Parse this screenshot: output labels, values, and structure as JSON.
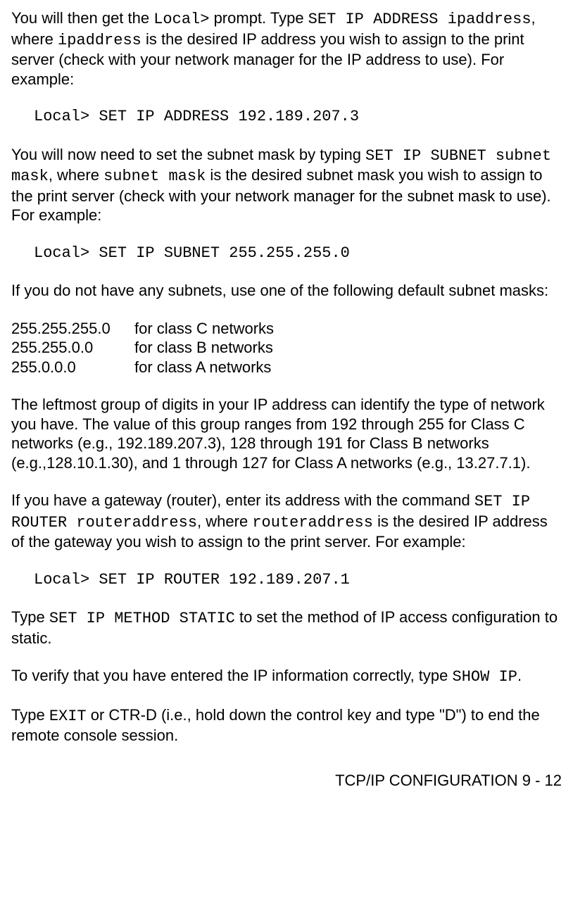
{
  "para1": {
    "t1": "You will then get the ",
    "c1": "Local>",
    "t2": " prompt. Type ",
    "c2": "SET IP ADDRESS ipaddress",
    "t3": ", where ",
    "c3": "ipaddress",
    "t4": " is the desired IP address you wish to assign to the print server (check with your network manager for the IP address to use). For example:"
  },
  "code1": "Local> SET IP ADDRESS 192.189.207.3",
  "para2": {
    "t1": "You will now need to set the subnet mask by typing ",
    "c1": "SET IP SUBNET subnet mask",
    "t2": ", where ",
    "c2": "subnet mask",
    "t3": " is the desired subnet mask you wish to assign to the print server (check with your network manager for the subnet mask to use). For example:"
  },
  "code2": "Local> SET IP SUBNET 255.255.255.0",
  "para3": "If you do not have any subnets, use one of the following default subnet masks:",
  "table": [
    {
      "mask": "255.255.255.0",
      "desc": "for class C networks"
    },
    {
      "mask": "255.255.0.0",
      "desc": "for class B networks"
    },
    {
      "mask": "255.0.0.0",
      "desc": "for class A networks"
    }
  ],
  "para4": "The leftmost group of digits in your IP address can identify the type of network you have. The value of this group ranges from 192 through 255 for Class C networks (e.g., 192.189.207.3), 128 through 191 for Class B networks (e.g.,128.10.1.30), and 1 through 127 for Class A networks (e.g., 13.27.7.1).",
  "para5": {
    "t1": "If you have a gateway (router), enter its address with the command ",
    "c1": "SET IP ROUTER routeraddress",
    "t2": ", where ",
    "c2": "routeraddress",
    "t3": " is the desired IP address of the gateway you wish to assign to the print server. For example:"
  },
  "code3": "Local> SET IP ROUTER 192.189.207.1",
  "para6": {
    "t1": "Type ",
    "c1": "SET IP METHOD STATIC",
    "t2": " to set the method of IP access configuration to static."
  },
  "para7": {
    "t1": "To verify that you have entered the IP information correctly, type ",
    "c1": "SHOW IP",
    "t2": "."
  },
  "para8": {
    "t1": "Type ",
    "c1": "EXIT",
    "t2": " or CTR-D (i.e., hold down the control key and type \"D\") to end the remote console session."
  },
  "footer": "TCP/IP CONFIGURATION 9 - 12"
}
